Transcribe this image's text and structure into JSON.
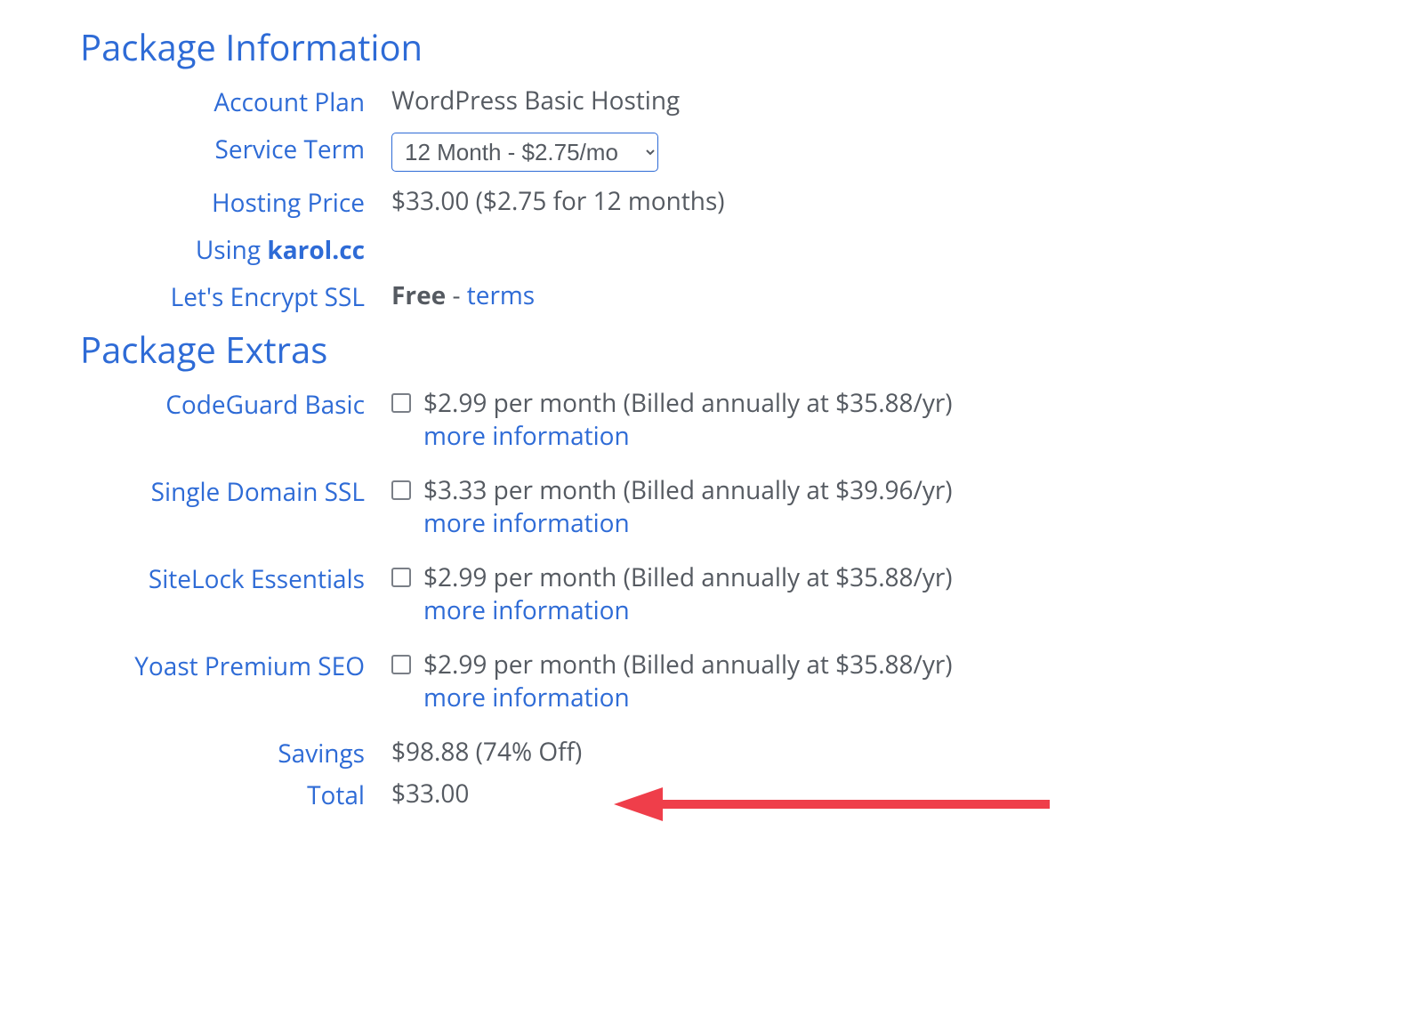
{
  "section1": {
    "title": "Package Information",
    "rows": {
      "account_plan": {
        "label": "Account Plan",
        "value": "WordPress Basic Hosting"
      },
      "service_term": {
        "label": "Service Term",
        "selected": "12 Month - $2.75/mo"
      },
      "hosting_price": {
        "label": "Hosting Price",
        "value": "$33.00 ($2.75 for 12 months)"
      },
      "using_domain": {
        "label_prefix": "Using ",
        "domain": "karol.cc"
      },
      "ssl": {
        "label": "Let's Encrypt SSL",
        "value_bold": "Free",
        "separator": " - ",
        "link": "terms"
      }
    }
  },
  "section2": {
    "title": "Package Extras",
    "more_info_label": "more information",
    "extras": [
      {
        "label": "CodeGuard Basic",
        "price_text": "$2.99 per month (Billed annually at $35.88/yr)"
      },
      {
        "label": "Single Domain SSL",
        "price_text": "$3.33 per month (Billed annually at $39.96/yr)"
      },
      {
        "label": "SiteLock Essentials",
        "price_text": "$2.99 per month (Billed annually at $35.88/yr)"
      },
      {
        "label": "Yoast Premium SEO",
        "price_text": "$2.99 per month (Billed annually at $35.88/yr)"
      }
    ]
  },
  "summary": {
    "savings": {
      "label": "Savings",
      "value": "$98.88 (74% Off)"
    },
    "total": {
      "label": "Total",
      "value": "$33.00"
    }
  }
}
